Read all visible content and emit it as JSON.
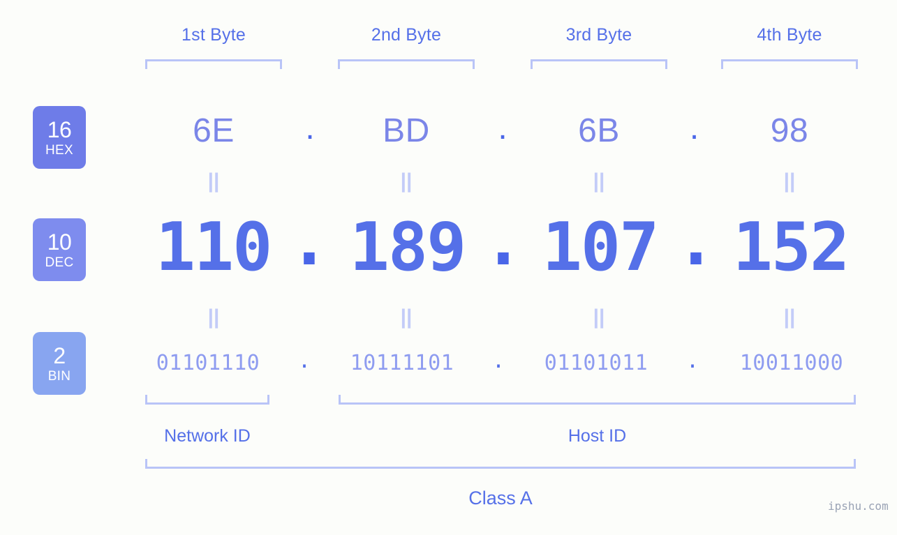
{
  "background_color": "#fcfdfa",
  "accent_color": "#5570e8",
  "bracket_color": "#b9c4f7",
  "byte_headers": [
    {
      "label": "1st Byte"
    },
    {
      "label": "2nd Byte"
    },
    {
      "label": "3rd Byte"
    },
    {
      "label": "4th Byte"
    }
  ],
  "rows": [
    {
      "badge_number": "16",
      "badge_system": "HEX",
      "badge_color": "#6e7ce8",
      "values": [
        "6E",
        "BD",
        "6B",
        "98"
      ],
      "separator": "."
    },
    {
      "badge_number": "10",
      "badge_system": "DEC",
      "badge_color": "#7e8cee",
      "values": [
        "110",
        "189",
        "107",
        "152"
      ],
      "separator": "."
    },
    {
      "badge_number": "2",
      "badge_system": "BIN",
      "badge_color": "#88a5f0",
      "values": [
        "01101110",
        "10111101",
        "01101011",
        "10011000"
      ],
      "separator": "."
    }
  ],
  "equals_symbol": "||",
  "id_sections": [
    {
      "label": "Network ID"
    },
    {
      "label": "Host ID"
    }
  ],
  "class_label": "Class A",
  "watermark": "ipshu.com"
}
